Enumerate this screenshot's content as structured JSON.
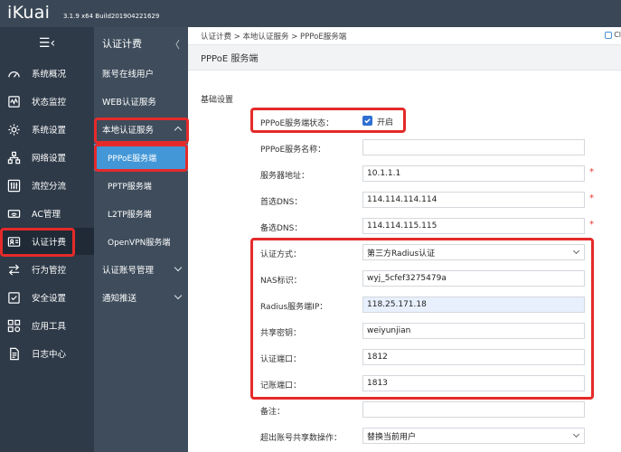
{
  "brand": {
    "logo": "iKuai",
    "version": "3.1.9 x64 Build201904221629"
  },
  "sidebar": {
    "items": [
      {
        "label": "系统概况",
        "icon": "speedometer-icon"
      },
      {
        "label": "状态监控",
        "icon": "monitor-icon"
      },
      {
        "label": "系统设置",
        "icon": "gear-icon"
      },
      {
        "label": "网络设置",
        "icon": "network-icon"
      },
      {
        "label": "流控分流",
        "icon": "sliders-icon"
      },
      {
        "label": "AC管理",
        "icon": "wifi-icon"
      },
      {
        "label": "认证计费",
        "icon": "id-card-icon"
      },
      {
        "label": "行为管控",
        "icon": "arrows-icon"
      },
      {
        "label": "安全设置",
        "icon": "shield-icon"
      },
      {
        "label": "应用工具",
        "icon": "apps-icon"
      },
      {
        "label": "日志中心",
        "icon": "log-icon"
      }
    ]
  },
  "subnav": {
    "title": "认证计费",
    "items": [
      {
        "label": "账号在线用户"
      },
      {
        "label": "WEB认证服务"
      },
      {
        "label": "本地认证服务"
      },
      {
        "label": "PPPoE服务端"
      },
      {
        "label": "PPTP服务端"
      },
      {
        "label": "L2TP服务端"
      },
      {
        "label": "OpenVPN服务端"
      },
      {
        "label": "认证账号管理"
      },
      {
        "label": "通知推送"
      }
    ]
  },
  "breadcrumb": {
    "text": "认证计费 > 本地认证服务 > PPPoE服务端",
    "right": "Cl"
  },
  "page": {
    "title": "PPPoE 服务端",
    "section": "基础设置"
  },
  "form": {
    "status_label": "PPPoE服务端状态：",
    "status_value": "开启",
    "name_label": "PPPoE服务名称：",
    "name_value": "",
    "server_label": "服务器地址：",
    "server_value": "10.1.1.1",
    "dns1_label": "首选DNS：",
    "dns1_value": "114.114.114.114",
    "dns2_label": "备选DNS：",
    "dns2_value": "114.114.115.115",
    "auth_label": "认证方式：",
    "auth_value": "第三方Radius认证",
    "nas_label": "NAS标识：",
    "nas_value": "wyj_5cfef3275479a",
    "radius_ip_label": "Radius服务端IP：",
    "radius_ip_value": "118.25.171.18",
    "secret_label": "共享密钥：",
    "secret_value": "weiyunjian",
    "auth_port_label": "认证端口：",
    "auth_port_value": "1812",
    "acct_port_label": "记账端口：",
    "acct_port_value": "1813",
    "note_label": "备注：",
    "note_value": "",
    "exceed_label": "超出账号共享数操作：",
    "exceed_value": "替换当前用户",
    "required_mark": "*"
  },
  "colors": {
    "highlight": "#e52a2a",
    "selected": "#4497d7",
    "sidebar": "#2e3a48"
  }
}
